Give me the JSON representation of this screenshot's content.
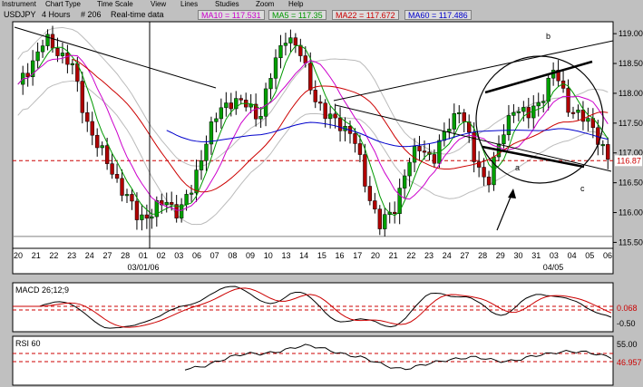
{
  "menu": {
    "items": [
      "Instrument",
      "Chart Type",
      "Time Scale",
      "View",
      "Lines",
      "Studies",
      "Zoom",
      "Help"
    ]
  },
  "header": {
    "symbol": "USDJPY",
    "timeframe": "4 Hours",
    "bars": "# 206",
    "feed": "Real-time data",
    "ma10": "MA10 = 117.531",
    "ma5": "MA5 = 117.35",
    "ma22": "MA22 = 117.672",
    "ma60": "MA60 = 117.486"
  },
  "colors": {
    "ma10": "#cc00cc",
    "ma5": "#009900",
    "ma22": "#cc0000",
    "ma60": "#0000cc",
    "bull": "#00a000",
    "bear": "#b00000",
    "level": "#cc0000"
  },
  "chart_data": [
    {
      "type": "candlestick",
      "title": "USDJPY , 4 Hours , # 206, Real-time data",
      "ylim": [
        115.4,
        119.2
      ],
      "yticks": [
        "119.00",
        "118.50",
        "118.00",
        "117.50",
        "117.00",
        "116.50",
        "116.00",
        "115.50"
      ],
      "level_label": "116.87",
      "x_labels": [
        "20",
        "21",
        "22",
        "23",
        "24",
        "27",
        "28",
        "01",
        "02",
        "03",
        "06",
        "07",
        "08",
        "09",
        "10",
        "13",
        "14",
        "15",
        "16",
        "17",
        "20",
        "21",
        "22",
        "23",
        "24",
        "27",
        "28",
        "29",
        "30",
        "31",
        "03",
        "04",
        "05",
        "06"
      ],
      "x_sublabels": [
        "03/01/06",
        "04/05"
      ],
      "annotations": [
        "a",
        "b",
        "c"
      ],
      "price_path": [
        118.1,
        118.5,
        118.9,
        118.7,
        118.5,
        117.6,
        117.1,
        116.7,
        116.3,
        115.9,
        116.0,
        116.2,
        116.0,
        116.4,
        117.2,
        117.7,
        117.9,
        117.8,
        117.6,
        118.4,
        119.0,
        118.7,
        118.0,
        117.6,
        117.5,
        117.3,
        116.4,
        115.8,
        116.0,
        116.8,
        117.1,
        116.9,
        117.4,
        117.8,
        116.9,
        116.5,
        117.2,
        117.8,
        117.6,
        117.9,
        118.4,
        117.8,
        117.6,
        117.4,
        116.9
      ]
    },
    {
      "type": "line",
      "title": "MACD 26;12;9",
      "yticks": [
        "0.068",
        "-0.50"
      ]
    },
    {
      "type": "line",
      "title": "RSI 60",
      "yticks": [
        "55.00",
        "46.957"
      ]
    }
  ]
}
